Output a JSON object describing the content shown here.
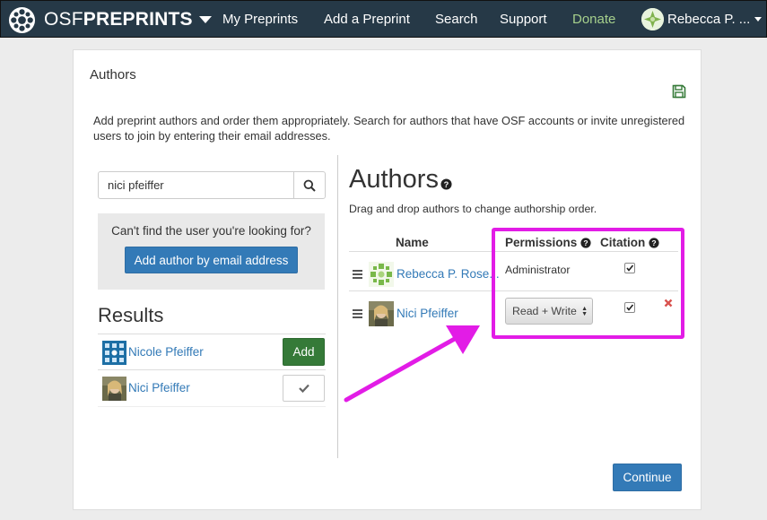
{
  "nav": {
    "brand_prefix": "OSF",
    "brand_suffix": "PREPRINTS",
    "links": [
      "My Preprints",
      "Add a Preprint",
      "Search",
      "Support",
      "Donate"
    ],
    "user_name": "Rebecca P. ..."
  },
  "panel": {
    "heading": "Authors",
    "intro": "Add preprint authors and order them appropriately. Search for authors that have OSF accounts or invite unregistered users to join by entering their email addresses."
  },
  "search": {
    "value": "nici pfeiffer"
  },
  "not_found": {
    "text": "Can't find the user you're looking for?",
    "button": "Add author by email address"
  },
  "results": {
    "title": "Results",
    "items": [
      {
        "name": "Nicole Pfeiffer",
        "action": "Add"
      },
      {
        "name": "Nici Pfeiffer",
        "action": "added-check"
      }
    ]
  },
  "authors": {
    "title": "Authors",
    "hint": "Drag and drop authors to change authorship order.",
    "columns": {
      "name": "Name",
      "permissions": "Permissions",
      "citation": "Citation"
    },
    "rows": [
      {
        "name": "Rebecca P. Rose...",
        "permission": "Administrator",
        "citation": true
      },
      {
        "name": "Nici Pfeiffer",
        "permission": "Read + Write",
        "citation": true
      }
    ]
  },
  "footer": {
    "continue": "Continue"
  },
  "colors": {
    "nav_bg": "#263947",
    "primary": "#337ab7",
    "success": "#357a38",
    "donate": "#a6d08c",
    "highlight": "#e21ce6",
    "remove": "#d9534f"
  },
  "icons": [
    "osf-logo-icon",
    "caret-down-icon",
    "save-icon",
    "search-icon",
    "help-icon",
    "drag-handle-icon",
    "check-icon",
    "remove-icon",
    "arrow-annotation"
  ]
}
